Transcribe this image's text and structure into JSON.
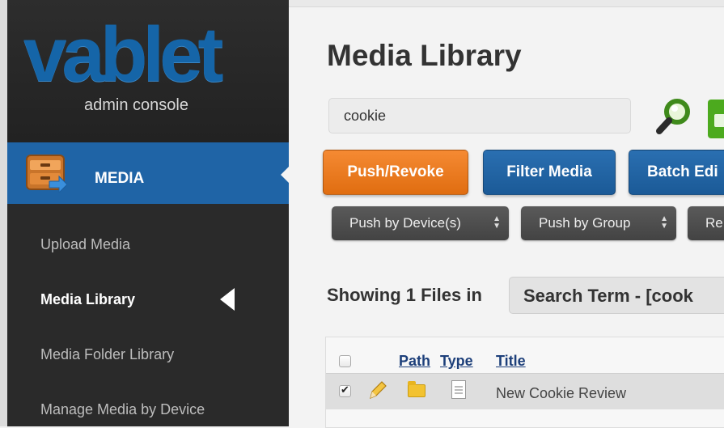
{
  "brand": {
    "logo": "vablet",
    "subtitle": "admin console"
  },
  "sidebar": {
    "section": "MEDIA",
    "items": [
      {
        "label": "Upload Media",
        "active": false
      },
      {
        "label": "Media Library",
        "active": true
      },
      {
        "label": "Media Folder Library",
        "active": false
      },
      {
        "label": "Manage Media by Device",
        "active": false
      }
    ]
  },
  "main": {
    "title": "Media Library",
    "search": {
      "value": "cookie"
    },
    "buttons": {
      "push_revoke": "Push/Revoke",
      "filter_media": "Filter Media",
      "batch_edit": "Batch Edi"
    },
    "selects": {
      "push_device": "Push by Device(s)",
      "push_group": "Push by Group",
      "third": "Re"
    },
    "showing": "Showing 1 Files in",
    "search_term": "Search Term - [cook",
    "table": {
      "columns": {
        "path": "Path",
        "type": "Type",
        "title": "Title"
      },
      "rows": [
        {
          "title": "New Cookie Review",
          "checked": true
        }
      ]
    }
  },
  "colors": {
    "accent_blue": "#1f64a6",
    "orange": "#f07d22",
    "sidebar_bg": "#2a2a2a"
  }
}
